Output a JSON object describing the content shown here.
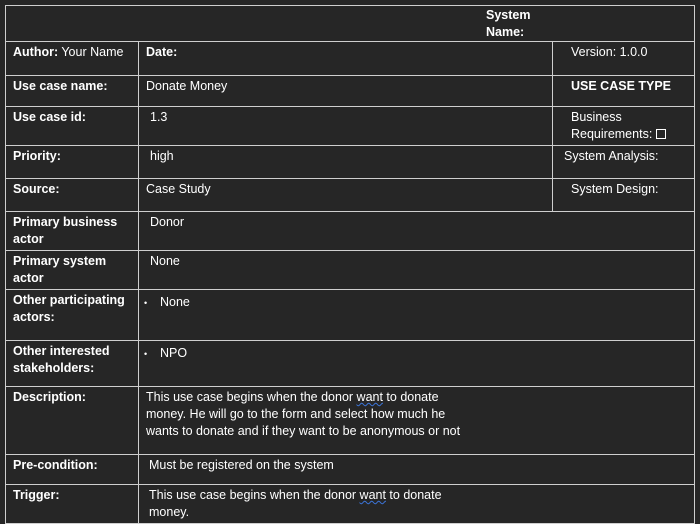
{
  "system_name": "System Name:",
  "author": {
    "label": "Author:",
    "value": " Your Name"
  },
  "date_label": "Date:",
  "version": "Version: 1.0.0",
  "use_case_name": {
    "label": "Use case name:",
    "value": "Donate Money"
  },
  "use_case_type": "USE CASE TYPE",
  "use_case_id": {
    "label": "Use case id:",
    "value": "1.3"
  },
  "business_requirements": "Business Requirements:",
  "priority": {
    "label": "Priority:",
    "value": "high"
  },
  "system_analysis": "System Analysis:",
  "source": {
    "label": "Source:",
    "value": "Case Study"
  },
  "system_design": "System Design:",
  "primary_business_actor": {
    "label": "Primary business actor",
    "value": "Donor"
  },
  "primary_system_actor": {
    "label": "Primary system actor",
    "value": "None"
  },
  "other_participating": {
    "label": "Other participating actors:",
    "value": "None"
  },
  "other_interested": {
    "label": "Other interested stakeholders:",
    "value": "NPO"
  },
  "description": {
    "label": "Description:",
    "pre": "This use case begins when the donor ",
    "word": "want",
    "post": " to donate money. He will go to the form and select how much he wants to donate and if they want to be anonymous or not"
  },
  "precondition": {
    "label": "Pre-condition:",
    "value": "Must be registered on the system"
  },
  "trigger": {
    "label": "Trigger:",
    "pre": "This use case begins when the donor ",
    "word": "want",
    "post": " to donate money."
  }
}
